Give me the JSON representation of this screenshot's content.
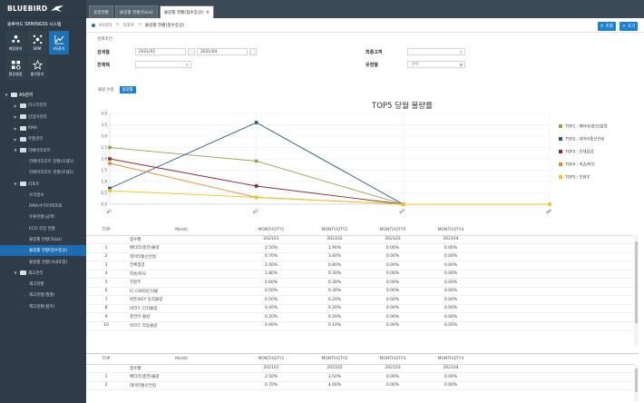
{
  "app": {
    "logo": "BLUEBIRD",
    "system_name": "블루버드 SRM/NGSS 시스템"
  },
  "quick_buttons": [
    {
      "label": "계정관리",
      "icon": "users-icon"
    },
    {
      "label": "SRM",
      "icon": "network-icon"
    },
    {
      "label": "AS관리",
      "icon": "chart-icon",
      "active": true
    },
    {
      "label": "환경설정",
      "icon": "settings-icon"
    },
    {
      "label": "즐겨찾기",
      "icon": "star-icon"
    }
  ],
  "tree": [
    {
      "label": "AS관리",
      "level": 1,
      "folder": true,
      "expanded": true
    },
    {
      "label": "마스터관리",
      "level": 2,
      "folder": true
    },
    {
      "label": "인입이관리",
      "level": 2,
      "folder": true
    },
    {
      "label": "RMA",
      "level": 2,
      "folder": true
    },
    {
      "label": "부품관리",
      "level": 2,
      "folder": true
    },
    {
      "label": "리페어리포트",
      "level": 2,
      "folder": true,
      "expanded": true
    },
    {
      "label": "리페어리포트 현황(모델1)",
      "level": 3
    },
    {
      "label": "리페어리포트 현황(모델2)",
      "level": 3
    },
    {
      "label": "리포트",
      "level": 2,
      "folder": true,
      "expanded": true
    },
    {
      "label": "수리정보",
      "level": 3
    },
    {
      "label": "RMA/수리이력조회",
      "level": 3
    },
    {
      "label": "유류현황(금액)",
      "level": 3
    },
    {
      "label": "ECO 현장 현황",
      "level": 3
    },
    {
      "label": "불량률 현황(Total)",
      "level": 3
    },
    {
      "label": "불량률 현황(접수증상)",
      "level": 3,
      "selected": true
    },
    {
      "label": "불량률 현황(사내포함)",
      "level": 3
    },
    {
      "label": "재고관리",
      "level": 2,
      "folder": true,
      "expanded": true
    },
    {
      "label": "재고현황",
      "level": 3
    },
    {
      "label": "재고현황(월별)",
      "level": 3
    },
    {
      "label": "재고현황(품목)",
      "level": 3
    }
  ],
  "tabs": [
    {
      "label": "종합현황",
      "active": false
    },
    {
      "label": "불량률 현황(Total)",
      "active": false
    },
    {
      "label": "불량률 현황(접수증상)",
      "active": true,
      "close": "×"
    }
  ],
  "breadcrumb": [
    "AS관리",
    "리포트",
    "불량률 현황(접수증상)"
  ],
  "buttons": {
    "search": "조회",
    "reset": "초기"
  },
  "search": {
    "title": "검색조건",
    "period_label": "검색월",
    "from": "2021/01",
    "to": "2021/04",
    "product_label": "전체제",
    "customer_label": "최종고객",
    "type_label": "유형별",
    "type_value": "선택"
  },
  "chart_tabs": [
    {
      "label": "불량 수량",
      "active": false
    },
    {
      "label": "불량률",
      "active": true
    }
  ],
  "chart_data": {
    "type": "line",
    "title": "TOP5 당월 불량률",
    "categories": [
      "M1",
      "M2",
      "M3",
      "M4"
    ],
    "ylim": [
      0,
      4.0
    ],
    "yticks": [
      "4.0",
      "3.5",
      "3.0",
      "2.5",
      "2.0",
      "1.5",
      "1.0",
      "0.5",
      "0.0"
    ],
    "legend_position": "right",
    "series": [
      {
        "name": "TOP1 : 배터리(충전)불량",
        "color": "#8ea64a",
        "values": [
          2.5,
          1.9,
          0.0,
          null
        ]
      },
      {
        "name": "TOP2 : 데이터통신안됨",
        "color": "#1f5a8c",
        "values": [
          0.7,
          3.6,
          0.0,
          null
        ]
      },
      {
        "name": "TOP3 : 전체점검",
        "color": "#8b2a2a",
        "values": [
          2.0,
          0.8,
          0.0,
          null
        ]
      },
      {
        "name": "TOP4 : 파손/마모",
        "color": "#e8892a",
        "values": [
          1.8,
          0.3,
          0.0,
          null
        ]
      },
      {
        "name": "TOP5 : 전원부",
        "color": "#f0c419",
        "values": [
          0.6,
          0.3,
          0.0,
          0.0
        ]
      }
    ]
  },
  "grid1": {
    "headers": [
      "TOP",
      "Month",
      "MONTHQTY1",
      "MONTHQTY2",
      "MONTHQTY3",
      "MONTHQTY4"
    ],
    "rows": [
      [
        "",
        "접수월",
        "202101",
        "202102",
        "202103",
        "202104"
      ],
      [
        "1",
        "배터리(충전)불량",
        "2.50%",
        "1.90%",
        "0.00%",
        "0.00%"
      ],
      [
        "2",
        "데이터통신안됨",
        "0.70%",
        "3.60%",
        "0.00%",
        "0.00%"
      ],
      [
        "3",
        "전체점검",
        "2.00%",
        "0.80%",
        "0.00%",
        "0.00%"
      ],
      [
        "4",
        "파손/마모",
        "1.80%",
        "0.30%",
        "0.00%",
        "0.00%"
      ],
      [
        "5",
        "전원부",
        "0.60%",
        "0.30%",
        "0.00%",
        "0.00%"
      ],
      [
        "6",
        "IC CARD인식불",
        "0.50%",
        "0.30%",
        "0.00%",
        "0.00%"
      ],
      [
        "7",
        "버튼/KEY 동작불량",
        "0.50%",
        "0.20%",
        "0.00%",
        "0.00%"
      ],
      [
        "8",
        "바코드 인식불량",
        "0.40%",
        "0.20%",
        "0.00%",
        "0.00%"
      ],
      [
        "9",
        "충전이 불량",
        "0.20%",
        "0.20%",
        "0.00%",
        "0.00%"
      ],
      [
        "10",
        "바코드 작동불량",
        "0.00%",
        "0.10%",
        "0.00%",
        "0.00%"
      ]
    ]
  },
  "grid2": {
    "headers": [
      "TOP",
      "Month",
      "MONTHQTY1",
      "MONTHQTY2",
      "MONTHQTY3",
      "MONTHQTY4"
    ],
    "rows": [
      [
        "",
        "접수월",
        "202101",
        "202102",
        "202103",
        "202104"
      ],
      [
        "1",
        "배터리(충전)불량",
        "2.50%",
        "3.50%",
        "0.00%",
        "0.00%"
      ],
      [
        "2",
        "데이터통신안됨",
        "0.70%",
        "4.00%",
        "0.00%",
        "0.00%"
      ]
    ]
  }
}
